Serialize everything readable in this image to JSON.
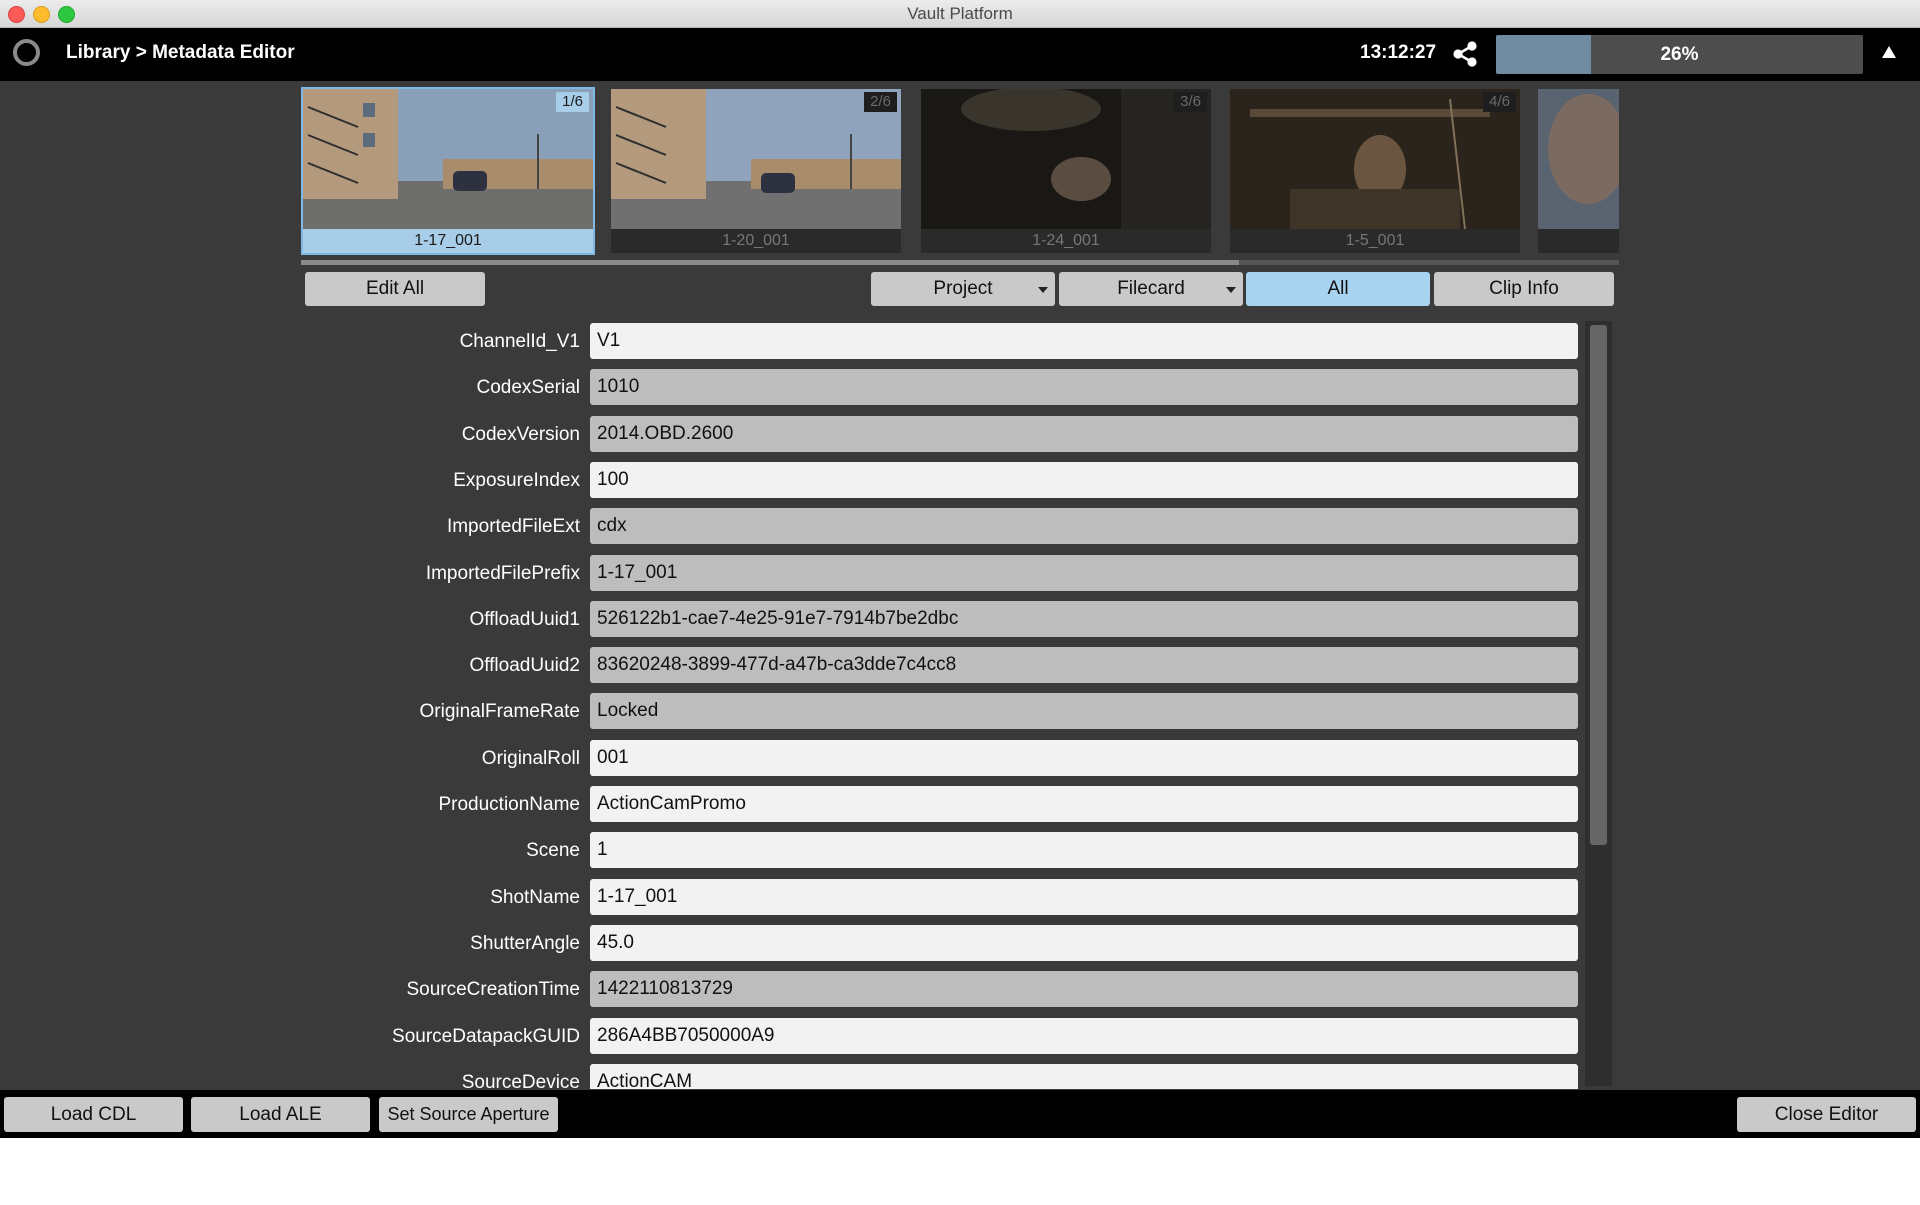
{
  "window": {
    "title": "Vault Platform"
  },
  "header": {
    "breadcrumb": "Library > Metadata Editor",
    "clock": "13:12:27",
    "progress_percent": 26,
    "progress_label": "26%"
  },
  "thumbnails": [
    {
      "caption": "1-17_001",
      "badge": "1/6",
      "selected": true
    },
    {
      "caption": "1-20_001",
      "badge": "2/6",
      "selected": false
    },
    {
      "caption": "1-24_001",
      "badge": "3/6",
      "selected": false
    },
    {
      "caption": "1-5_001",
      "badge": "4/6",
      "selected": false
    },
    {
      "caption": "",
      "badge": "",
      "selected": false
    }
  ],
  "toolbar": {
    "edit_all": "Edit All",
    "project": "Project",
    "filecard": "Filecard",
    "all": "All",
    "clip_info": "Clip Info"
  },
  "fields": [
    {
      "label": "ChannelId_V1",
      "value": "V1",
      "editable": true
    },
    {
      "label": "CodexSerial",
      "value": "1010",
      "editable": false
    },
    {
      "label": "CodexVersion",
      "value": "2014.OBD.2600",
      "editable": false
    },
    {
      "label": "ExposureIndex",
      "value": "100",
      "editable": true
    },
    {
      "label": "ImportedFileExt",
      "value": "cdx",
      "editable": false
    },
    {
      "label": "ImportedFilePrefix",
      "value": "1-17_001",
      "editable": false
    },
    {
      "label": "OffloadUuid1",
      "value": "526122b1-cae7-4e25-91e7-7914b7be2dbc",
      "editable": false
    },
    {
      "label": "OffloadUuid2",
      "value": "83620248-3899-477d-a47b-ca3dde7c4cc8",
      "editable": false
    },
    {
      "label": "OriginalFrameRate",
      "value": "Locked",
      "editable": false
    },
    {
      "label": "OriginalRoll",
      "value": "001",
      "editable": true
    },
    {
      "label": "ProductionName",
      "value": "ActionCamPromo",
      "editable": true
    },
    {
      "label": "Scene",
      "value": "1",
      "editable": true
    },
    {
      "label": "ShotName",
      "value": "1-17_001",
      "editable": true
    },
    {
      "label": "ShutterAngle",
      "value": "45.0",
      "editable": true
    },
    {
      "label": "SourceCreationTime",
      "value": "1422110813729",
      "editable": false
    },
    {
      "label": "SourceDatapackGUID",
      "value": "286A4BB7050000A9",
      "editable": true
    },
    {
      "label": "SourceDevice",
      "value": "ActionCAM",
      "editable": true
    }
  ],
  "footer": {
    "load_cdl": "Load CDL",
    "load_ale": "Load ALE",
    "set_source_aperture": "Set Source Aperture",
    "close_editor": "Close Editor"
  },
  "colors": {
    "accent_selected": "#a8d4f2",
    "progress_fill": "#6f8aa1",
    "background": "#3a3a3a"
  }
}
